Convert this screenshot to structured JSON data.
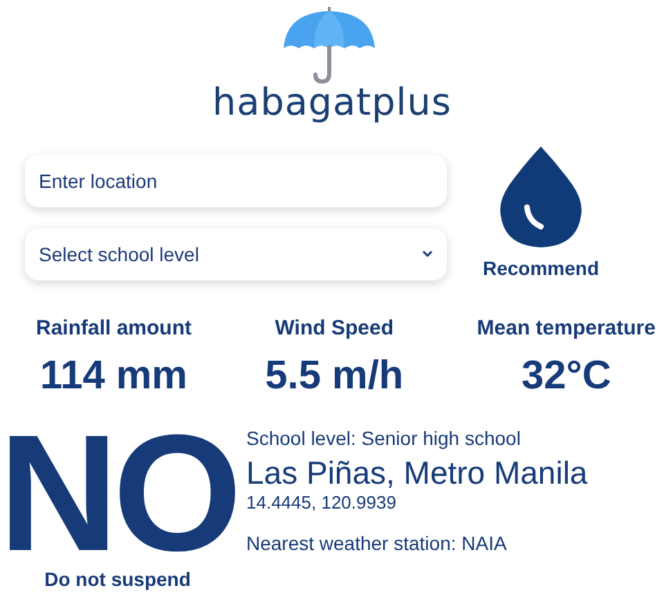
{
  "logo": {
    "text": "habagatplus"
  },
  "location_field": {
    "placeholder": "Enter location"
  },
  "school_level_select": {
    "value": "Select school level"
  },
  "recommend_button": {
    "label": "Recommend"
  },
  "stats": [
    {
      "label": "Rainfall amount",
      "value": "114 mm"
    },
    {
      "label": "Wind Speed",
      "value": "5.5 m/h"
    },
    {
      "label": "Mean temperature",
      "value": "32°C"
    }
  ],
  "result": {
    "verdict": "NO",
    "caption": "Do not suspend",
    "school_level": "School level: Senior high school",
    "location": "Las Piñas, Metro Manila",
    "coordinates": "14.4445, 120.9939",
    "station": "Nearest weather station: NAIA"
  }
}
